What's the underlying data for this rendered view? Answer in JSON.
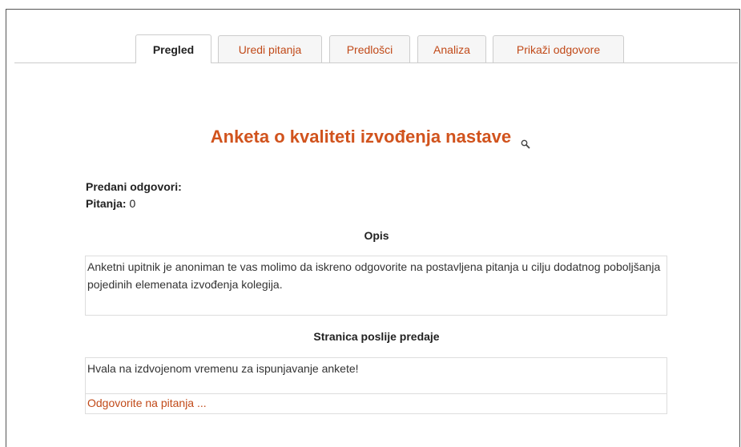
{
  "tabs": [
    {
      "label": "Pregled",
      "active": true
    },
    {
      "label": "Uredi pitanja",
      "active": false
    },
    {
      "label": "Predlošci",
      "active": false
    },
    {
      "label": "Analiza",
      "active": false
    },
    {
      "label": "Prikaži odgovore",
      "active": false
    }
  ],
  "page": {
    "title": "Anketa o kvaliteti izvođenja nastave",
    "title_icon": "search-icon",
    "submitted_label": "Predani odgovori:",
    "questions_label": "Pitanja:",
    "questions_value": "0"
  },
  "description": {
    "heading": "Opis",
    "text": "Anketni upitnik je anoniman te vas molimo da iskreno odgovorite na postavljena pitanja u cilju dodatnog poboljšanja pojedinih elemenata izvođenja kolegija."
  },
  "after_submit": {
    "heading": "Stranica poslije predaje",
    "text": "Hvala na izdvojenom vremenu za ispunjavanje ankete!",
    "link_label": "Odgovorite na pitanja ..."
  },
  "colors": {
    "accent": "#d1531d",
    "link": "#c14a19"
  }
}
